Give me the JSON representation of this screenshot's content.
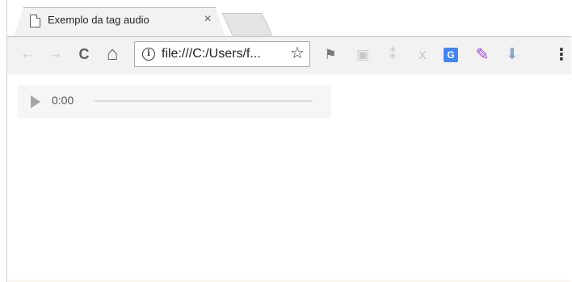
{
  "tab": {
    "title": "Exemplo da tag audio",
    "close_glyph": "×",
    "page_icon": "page-icon"
  },
  "toolbar": {
    "back_glyph": "←",
    "forward_glyph": "→",
    "reload_glyph": "C",
    "home_glyph": "⌂",
    "info_glyph": "i",
    "url": "file:///C:/Users/f...",
    "star_glyph": "☆",
    "menu_glyph": "⋮",
    "extensions": [
      {
        "name": "flag-extension-icon",
        "glyph": "⚑",
        "color": "#7a7a7a"
      },
      {
        "name": "camera-extension-icon",
        "glyph": "▣",
        "color": "#c8c8c8"
      },
      {
        "name": "dropbox-extension-icon",
        "glyph": "⁑",
        "color": "#c8c8c8"
      },
      {
        "name": "pdf-extension-icon",
        "glyph": "ⅹ",
        "color": "#c8c8c8"
      },
      {
        "name": "translate-extension-icon",
        "glyph": "G",
        "color": "#4285f4"
      },
      {
        "name": "pen-extension-icon",
        "glyph": "✎",
        "color": "#a14ad4"
      },
      {
        "name": "download-extension-icon",
        "glyph": "⬇",
        "color": "#8fa8c8"
      }
    ]
  },
  "audio": {
    "time": "0:00",
    "progress": 0
  }
}
